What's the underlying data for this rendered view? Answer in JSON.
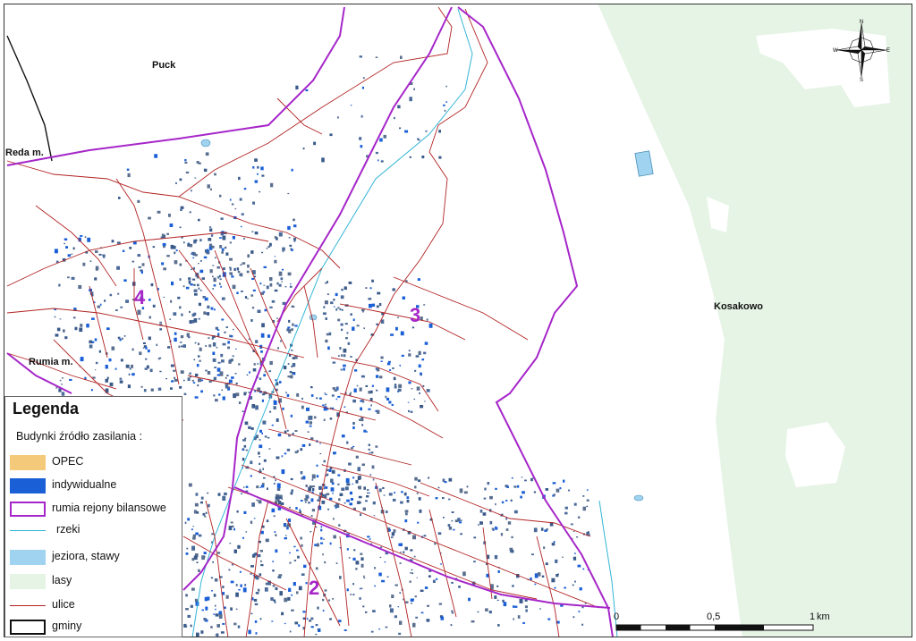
{
  "map": {
    "places": {
      "puck": "Puck",
      "reda": "Reda m.",
      "rumia": "Rumia m.",
      "kosakowo": "Kosakowo"
    },
    "regions": [
      "4",
      "3",
      "2"
    ],
    "compass": {
      "n": "N",
      "s": "S",
      "e": "E",
      "w": "W"
    },
    "scale": {
      "ticks": [
        "0",
        "0,5",
        "1"
      ],
      "unit": "km"
    },
    "colors": {
      "forest": "#e6f4e6",
      "region_boundary": "#a626c9",
      "road": "#b22222",
      "river": "#33b5d6",
      "lake": "#9fd3ef",
      "building_indiv": "#1a5fd6",
      "building_opec": "#f5c97a",
      "gmina": "#111111"
    }
  },
  "legend": {
    "title": "Legenda",
    "subtitle": "Budynki  źródło zasilania   :",
    "items": [
      {
        "label": "OPEC",
        "icon": "opec-swatch"
      },
      {
        "label": "indywidualne",
        "icon": "individual-swatch"
      },
      {
        "label": "rumia rejony bilansowe",
        "icon": "region-boundary-swatch"
      },
      {
        "label": "rzeki",
        "icon": "river-line"
      },
      {
        "label": "jeziora, stawy",
        "icon": "lake-swatch"
      },
      {
        "label": "lasy",
        "icon": "forest-swatch"
      },
      {
        "label": "ulice",
        "icon": "street-line"
      },
      {
        "label": "gminy",
        "icon": "municipality-swatch"
      }
    ]
  }
}
